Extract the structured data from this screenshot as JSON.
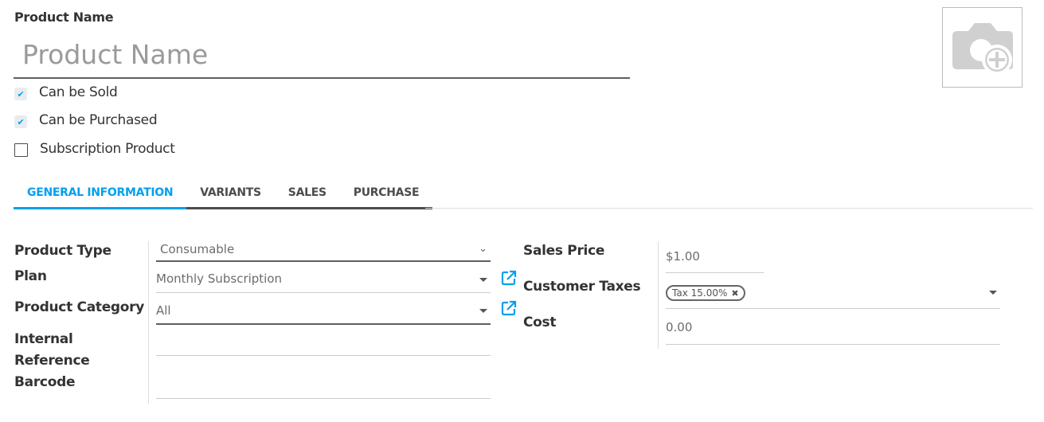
{
  "header": {
    "name_label": "Product Name",
    "name_placeholder": "Product Name",
    "name_value": ""
  },
  "options": [
    {
      "label": "Can be Sold",
      "checked": true
    },
    {
      "label": "Can be Purchased",
      "checked": true
    },
    {
      "label": "Subscription Product",
      "checked": false
    }
  ],
  "image": {
    "icon": "camera-plus-icon"
  },
  "tabs": [
    {
      "label": "GENERAL INFORMATION",
      "active": true
    },
    {
      "label": "VARIANTS",
      "active": false
    },
    {
      "label": "SALES",
      "active": false
    },
    {
      "label": "PURCHASE",
      "active": false
    }
  ],
  "left_fields": {
    "product_type": {
      "label": "Product Type",
      "value": "Consumable"
    },
    "plan": {
      "label": "Plan",
      "value": "Monthly Subscription"
    },
    "category": {
      "label": "Product Category",
      "value": "All"
    },
    "internal_ref": {
      "label_line1": "Internal",
      "label_line2": "Reference",
      "value": ""
    },
    "barcode": {
      "label": "Barcode",
      "value": ""
    }
  },
  "right_fields": {
    "sales_price": {
      "label": "Sales Price",
      "value": "$1.00"
    },
    "customer_taxes": {
      "label": "Customer Taxes",
      "tags": [
        "Tax 15.00%"
      ]
    },
    "cost": {
      "label": "Cost",
      "value": "0.00"
    }
  },
  "colors": {
    "accent": "#00a0f0",
    "text": "#4c4c4c",
    "muted": "#999999"
  }
}
